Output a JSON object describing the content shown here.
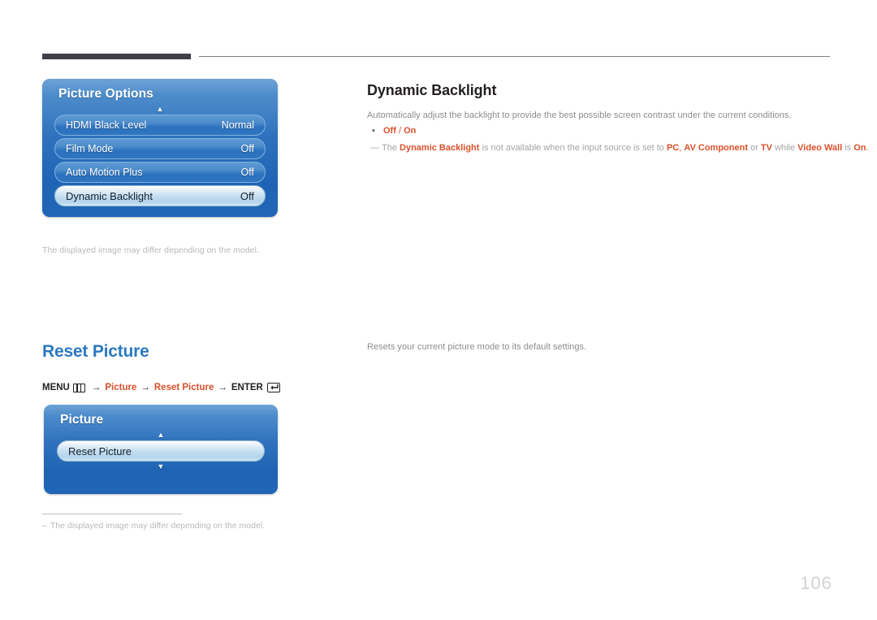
{
  "page": {
    "number": "106"
  },
  "header": {
    "bar_color": "#413c46",
    "line_color": "#7c7c7c"
  },
  "sections": {
    "dynamic_backlight": {
      "heading": "Dynamic Backlight",
      "description": "Automatically adjust the backlight to provide the best possible screen contrast under the current conditions.",
      "bullet": {
        "marker": "•",
        "option_off": "Off",
        "separator": " / ",
        "option_on": "On"
      },
      "note": {
        "dash": "—",
        "p1": "The ",
        "b1": "Dynamic Backlight",
        "p2": " is not available when the input source is set to ",
        "b2": "PC",
        "p3": ", ",
        "b3": "AV Component",
        "p4": " or ",
        "b4": "TV",
        "p5": " while ",
        "b5": "Video Wall",
        "p6": " is ",
        "b6": "On",
        "p7": "."
      },
      "caption": "The displayed image may differ depending on the model."
    },
    "reset_picture": {
      "heading": "Reset Picture",
      "description": "Resets your current picture mode to its default settings.",
      "menu_path": {
        "menu_label": "MENU",
        "menu_icon": "menu-grid-icon",
        "arrow": "→",
        "step1": "Picture",
        "step2": "Reset Picture",
        "enter_label": "ENTER",
        "enter_icon": "enter-key-icon"
      },
      "footnote": {
        "dash": "–",
        "text": "The displayed image may differ depending on the model."
      }
    }
  },
  "osd_panels": {
    "picture_options": {
      "title": "Picture Options",
      "scroll_up": "▲",
      "rows": [
        {
          "label": "HDMI Black Level",
          "value": "Normal",
          "selected": false
        },
        {
          "label": "Film Mode",
          "value": "Off",
          "selected": false
        },
        {
          "label": "Auto Motion Plus",
          "value": "Off",
          "selected": false
        },
        {
          "label": "Dynamic Backlight",
          "value": "Off",
          "selected": true
        }
      ]
    },
    "picture": {
      "title": "Picture",
      "scroll_up": "▲",
      "scroll_down": "▼",
      "rows": [
        {
          "label": "Reset Picture",
          "value": "",
          "selected": true
        }
      ]
    }
  },
  "colors": {
    "accent_orange": "#d9502a",
    "accent_blue": "#2a79c0",
    "osd_blue": "#2f71bd",
    "body_gray": "#8d8d92"
  }
}
